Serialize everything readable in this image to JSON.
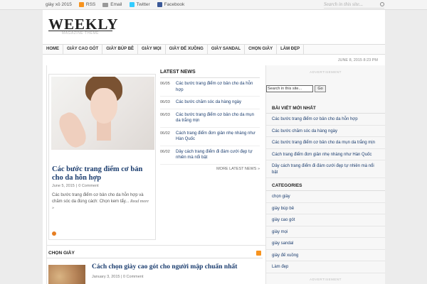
{
  "topbar": {
    "date_label": "giày xỏ 2015",
    "rss_label": "RSS",
    "email_label": "Email",
    "twitter_label": "Twitter",
    "facebook_label": "Facebook",
    "search_placeholder": "Search in this site..."
  },
  "header": {
    "logo": "WEEKLY",
    "tagline": "MAGAZINE THEME"
  },
  "nav": {
    "items": [
      "HOME",
      "GIÀY CAO GÓT",
      "GIÀY BÚP BÊ",
      "GIÀY MỌI",
      "GIÀY ĐẾ XUỒNG",
      "GIÀY SANDAL",
      "CHỌN GIÀY",
      "LÀM ĐẸP"
    ]
  },
  "date_line": "JUNE 8, 2015 8:23 PM",
  "featured": {
    "title": "Các bước trang điểm cơ bản cho da hỗn hợp",
    "date": "June 5, 2015",
    "comments": "0 Comment",
    "excerpt": "Các bước trang điểm cơ bản cho da hỗn hợp và chăm sóc da đúng cách: Chọn kem tẩy...",
    "read_more": "Read more »"
  },
  "latest": {
    "heading": "LATEST NEWS",
    "items": [
      {
        "date": "06/05",
        "title": "Các bước trang điểm cơ bản cho da hỗn hợp"
      },
      {
        "date": "06/03",
        "title": "Các bước chăm sóc da hàng ngày"
      },
      {
        "date": "06/03",
        "title": "Các bước trang điểm cơ bản cho da mụn da trắng mịn"
      },
      {
        "date": "06/02",
        "title": "Cách trang điểm đơn giản nhẹ nhàng như Hàn Quốc"
      },
      {
        "date": "06/02",
        "title": "Dây cách trang điểm đi đám cưới đẹp tự nhiên mà nổi bật"
      }
    ],
    "more": "MORE LATEST NEWS »"
  },
  "sidebar": {
    "ad_label": "ADVERTISEMENT",
    "search_value": "Search in this site...",
    "search_button": "Go",
    "recent_heading": "BÀI VIẾT MỚI NHẤT",
    "recent": [
      "Các bước trang điểm cơ bản cho da hỗn hợp",
      "Các bước chăm sóc da hàng ngày",
      "Các bước trang điểm cơ bản cho da mụn da trắng mịn",
      "Cách trang điểm đơn giản nhẹ nhàng như Hàn Quốc",
      "Dây cách trang điểm đi đám cưới đẹp tự nhiên mà nổi bật"
    ],
    "categories_heading": "CATEGORIES",
    "categories": [
      "chọn giày",
      "giày búp bê",
      "giày cao gót",
      "giày mọi",
      "giày sandal",
      "giày đế xuồng",
      "Làm đẹp"
    ],
    "ad_label_2": "ADVERTISEMENT"
  },
  "section": {
    "title": "CHỌN GIÀY"
  },
  "post": {
    "title": "Cách chọn giày cao gót cho người mập chuẩn nhất",
    "date": "January 3, 2015",
    "comments": "0 Comment"
  },
  "colors": {
    "link": "#1a3c6e",
    "accent": "#e67e22",
    "rss": "#f7931e",
    "twitter": "#33ccff",
    "facebook": "#3b5998"
  }
}
